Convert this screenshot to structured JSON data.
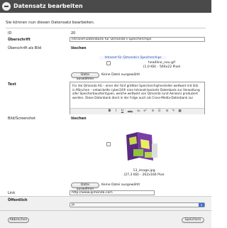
{
  "dialog": {
    "title": "Datensatz bearbeiten",
    "subtitle": "Sie können nun diesen Datensatz bearbeiten."
  },
  "fields": {
    "id_label": "ID",
    "id_value": "20",
    "headline_label": "Überschrift",
    "headline_value": "Intranet-Datenbank für Qimonda's Speicherchips",
    "headline_image_label": "Überschrift als Bild",
    "delete_label": "löschen",
    "banner_text": "Intranet für Qimonda's Speicherchips",
    "headline_image_name": "headline_neu.gif",
    "headline_image_info": "(1,0 KB) - 560x22 Pixel",
    "choose_file_button": "Datei auswählen",
    "no_file_text": "Keine Datei ausgewählt",
    "text_label": "Text",
    "text_value": "Für die Qimonda AG – einer der fünf größten Speicherchiphersteller weltweit mit Sitz in München – entwickelte cyber24® eine Intranet-basierte Datenbank zur Verwaltung aller Speicherbausteintypen, welche weltweit von Qimonda (und Aeneon) produziert werden. Diese Datenbank dient in der Folge auch als Cross-Media-Datenbank zur",
    "image_label": "Bild/Screenshot",
    "image_delete_label": "löschen",
    "image_name": "13_image.jpg",
    "image_info": "(27,3 KB) - 262x166 Pixe",
    "link_label": "Link",
    "link_value": "http://www.qimonda.com",
    "public_label": "Öffentlich",
    "public_value": "ja"
  },
  "toolbar": {
    "bold": "B",
    "italic": "I",
    "underline": "U",
    "strike": "ABC",
    "sub": "x₂",
    "sup": "x²",
    "list_ul": "≡",
    "list_ol": "☰",
    "link": "⊘",
    "pen": "✎",
    "code": "▦"
  },
  "footer": {
    "cancel_button": "Abbrechen",
    "save_button": "Speichern"
  }
}
